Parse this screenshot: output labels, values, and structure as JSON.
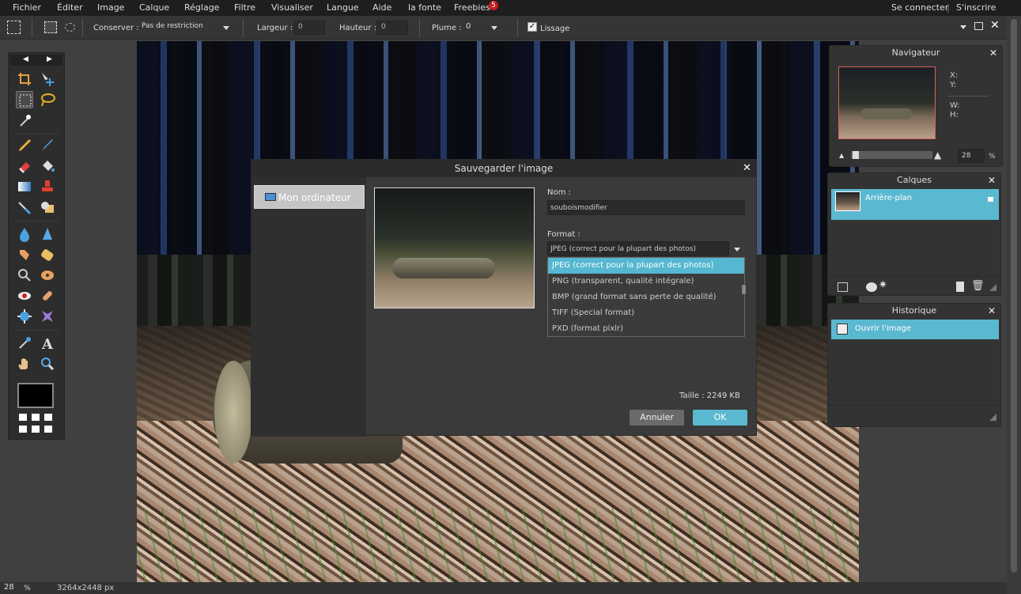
{
  "menubar": {
    "items": [
      "Fichier",
      "Éditer",
      "Image",
      "Calque",
      "Réglage",
      "Filtre",
      "Visualiser",
      "Langue",
      "Aide",
      "la fonte",
      "Freebies"
    ],
    "freebies_badge": "5",
    "login": "Se connecter",
    "separator": "|",
    "signup": "S'inscrire"
  },
  "options": {
    "keep_label": "Conserver :",
    "keep_value": "Pas de restriction",
    "width_label": "Largeur :",
    "width_value": "0",
    "height_label": "Hauteur :",
    "height_value": "0",
    "feather_label": "Plume :",
    "feather_value": "0",
    "smooth_label": "Lissage",
    "smooth_checked": true
  },
  "navigator": {
    "title": "Navigateur",
    "x_label": "X:",
    "y_label": "Y:",
    "w_label": "W:",
    "h_label": "H:",
    "zoom_value": "28",
    "zoom_unit": "%"
  },
  "layers": {
    "title": "Calques",
    "items": [
      {
        "name": "Arrière-plan"
      }
    ]
  },
  "history": {
    "title": "Historique",
    "items": [
      {
        "name": "Ouvrir l'image"
      }
    ]
  },
  "status": {
    "zoom": "28",
    "zoom_unit": "%",
    "dimensions": "3264x2448 px"
  },
  "dialog": {
    "title": "Sauvegarder l'image",
    "location": "Mon ordinateur",
    "name_label": "Nom :",
    "name_value": "souboismodifier",
    "format_label": "Format :",
    "format_value": "JPEG (correct pour la plupart des photos)",
    "format_options": [
      "JPEG (correct pour la plupart des photos)",
      "PNG (transparent, qualité intégrale)",
      "BMP (grand format sans perte de qualité)",
      "TIFF (Special format)",
      "PXD (format pixlr)"
    ],
    "size_text": "Taille : 2249 KB",
    "cancel_label": "Annuler",
    "ok_label": "OK"
  },
  "colors": {
    "accent": "#55b7d0",
    "foreground_swatch": "#000000",
    "badge": "#c8181c"
  }
}
